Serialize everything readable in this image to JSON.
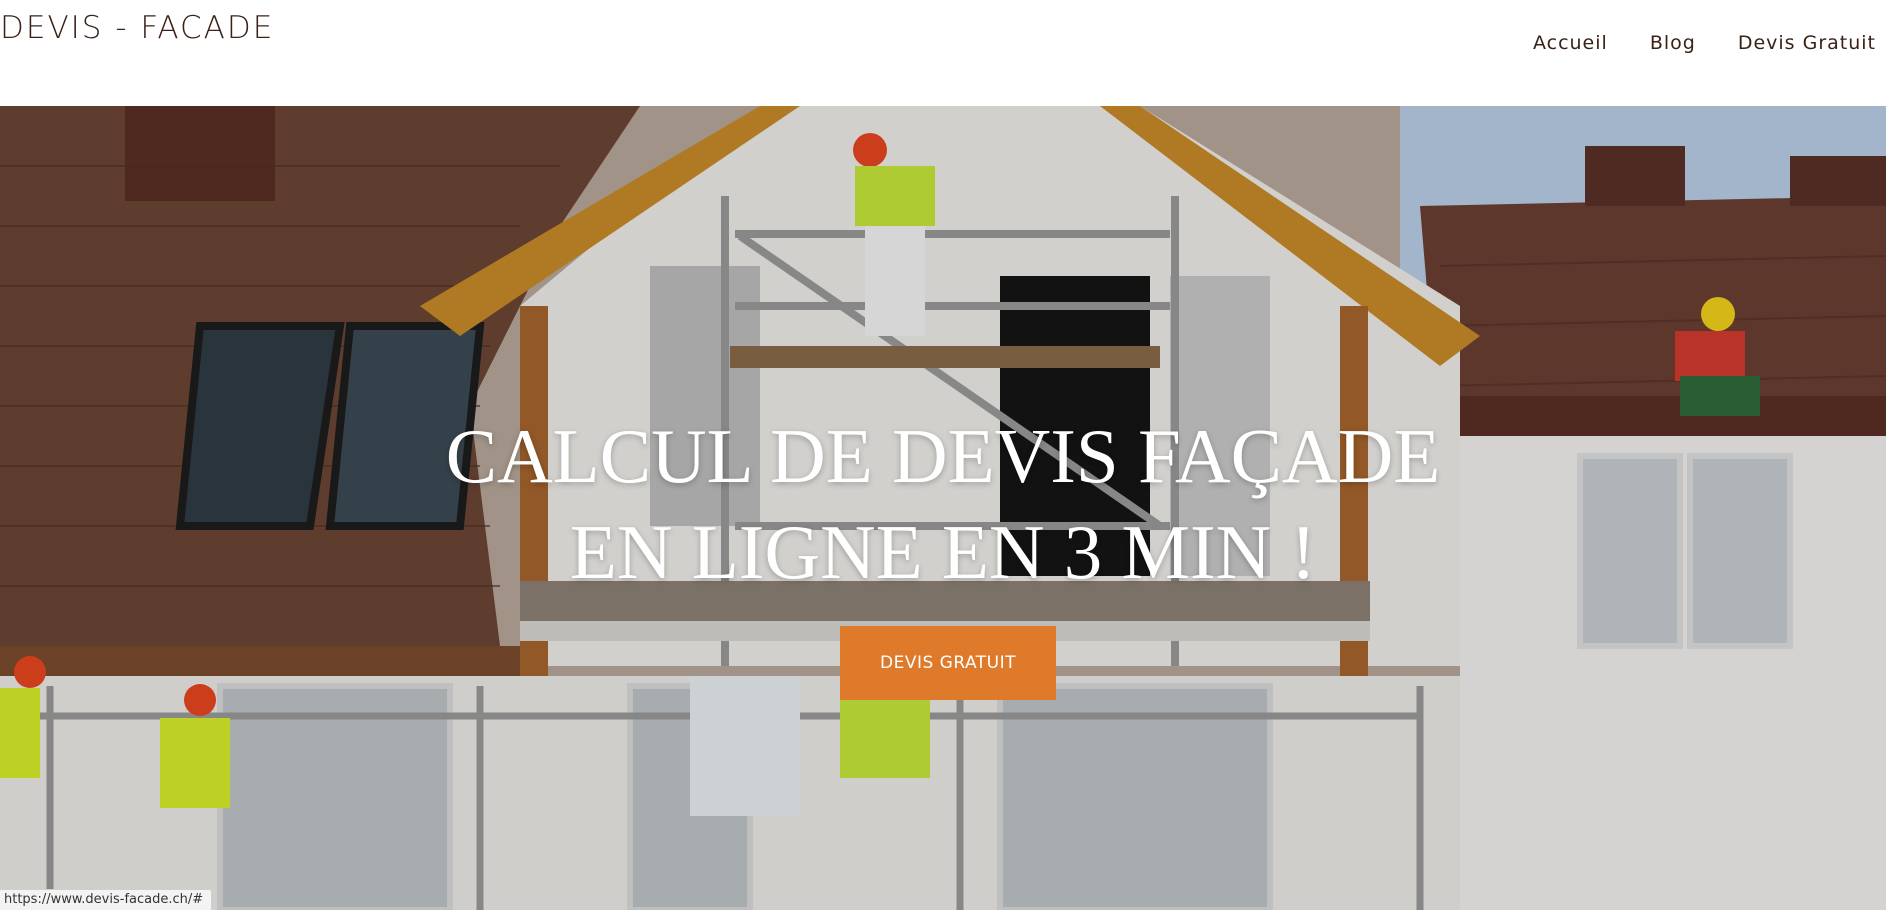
{
  "header": {
    "logo": "DEVIS - FACADE",
    "nav": [
      "Accueil",
      "Blog",
      "Devis Gratuit"
    ]
  },
  "hero": {
    "title_line1": "CALCUL DE DEVIS FAÇADE",
    "title_line2": "EN LIGNE EN 3 MIN !",
    "cta_label": "DEVIS GRATUIT"
  },
  "status_bar": {
    "url": "https://www.devis-facade.ch/#"
  },
  "colors": {
    "cta": "#de7a2a",
    "text_dark": "#3a2218",
    "roof": "#6b4535",
    "wall": "#f2f0ec"
  }
}
